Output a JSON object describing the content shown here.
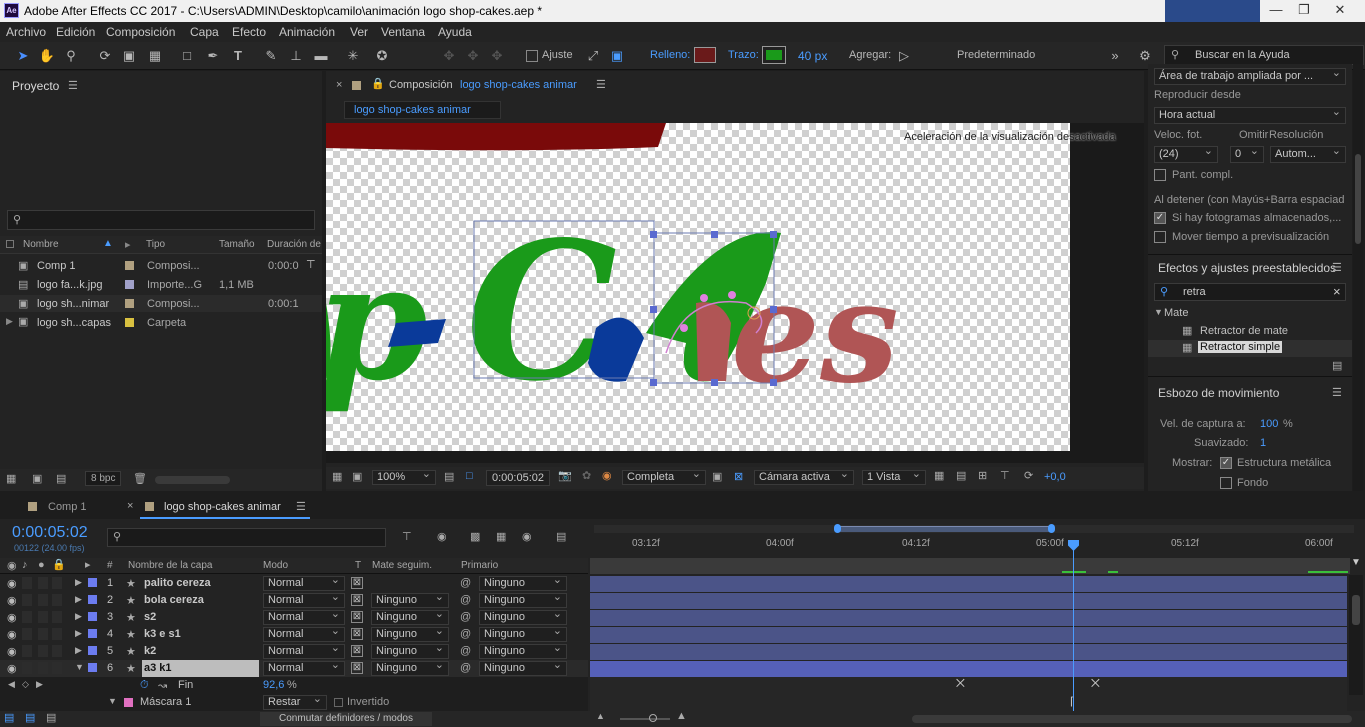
{
  "app": {
    "logo": "Ae",
    "title": "Adobe After Effects CC 2017 - C:\\Users\\ADMIN\\Desktop\\camilo\\animación logo shop-cakes.aep *"
  },
  "menu": [
    "Archivo",
    "Edición",
    "Composición",
    "Capa",
    "Efecto",
    "Animación",
    "Ver",
    "Ventana",
    "Ayuda"
  ],
  "toolbar": {
    "snap_label": "Ajuste",
    "fill_label": "Relleno:",
    "stroke_label": "Trazo:",
    "stroke_width": "40 px",
    "add_label": "Agregar:",
    "workspace": "Predeterminado",
    "help_placeholder": "Buscar en la Ayuda",
    "stroke_color": "#1a9a1a",
    "fill_color": "#8a2020"
  },
  "project": {
    "title": "Proyecto",
    "columns": [
      "Nombre",
      "Tipo",
      "Tamaño",
      "Duración de"
    ],
    "items": [
      {
        "name": "Comp 1",
        "type": "Composi...",
        "size": "",
        "duration": "0:00:0",
        "icon": "comp-icon",
        "label_color": "#b0a080"
      },
      {
        "name": "logo fa...k.jpg",
        "type": "Importe...G",
        "size": "1,1 MB",
        "duration": "",
        "icon": "image-icon",
        "label_color": "#a0a0c8"
      },
      {
        "name": "logo sh...nimar",
        "type": "Composi...",
        "size": "",
        "duration": "0:00:1",
        "icon": "comp-icon",
        "label_color": "#b0a080"
      },
      {
        "name": "logo sh...capas",
        "type": "Carpeta",
        "size": "",
        "duration": "",
        "icon": "folder-icon",
        "label_color": "#d8c040"
      }
    ],
    "bpc": "8 bpc"
  },
  "composition": {
    "panel_label": "Composición",
    "name": "logo shop-cakes animar",
    "tab": "logo shop-cakes animar",
    "accel_note": "Aceleración de la visualización desactivada",
    "zoom": "100%",
    "timecode": "0:00:05:02",
    "quality": "Completa",
    "camera": "Cámara activa",
    "views": "1 Vista",
    "exposure": "+0,0"
  },
  "preview": {
    "workspace_area": "Área de trabajo ampliada por ...",
    "play_from_label": "Reproducir desde",
    "play_from": "Hora actual",
    "fps_label": "Veloc. fot.",
    "skip_label": "Omitir",
    "res_label": "Resolución",
    "fps": "(24)",
    "skip": "0",
    "res": "Autom...",
    "fullscreen": "Pant. compl.",
    "on_stop": "Al detener (con Mayús+Barra espaciad",
    "cached": "Si hay fotogramas almacenados,...",
    "move_time": "Mover tiempo a previsualización"
  },
  "effects": {
    "title": "Efectos y ajustes preestablecidos",
    "search": "retra",
    "group": "Mate",
    "items": [
      "Retractor de mate",
      "Retractor simple"
    ]
  },
  "motion_sketch": {
    "title": "Esbozo de movimiento",
    "capture_label": "Vel. de captura a:",
    "capture_value": "100",
    "capture_unit": "%",
    "smooth_label": "Suavizado:",
    "smooth_value": "1",
    "show_label": "Mostrar:",
    "wireframe": "Estructura metálica",
    "background": "Fondo"
  },
  "timeline": {
    "tabs": [
      "Comp 1",
      "logo shop-cakes animar"
    ],
    "timecode": "0:00:05:02",
    "frames": "00122 (24.00 fps)",
    "ruler": [
      "03:12f",
      "04:00f",
      "04:12f",
      "05:00f",
      "05:12f",
      "06:00f"
    ],
    "columns": {
      "name": "Nombre de la capa",
      "mode": "Modo",
      "t": "T",
      "trkmat": "Mate seguim.",
      "parent": "Primario"
    },
    "layers": [
      {
        "num": "1",
        "name": "palito cereza",
        "mode": "Normal",
        "trkmat": "",
        "parent": "Ninguno"
      },
      {
        "num": "2",
        "name": "bola cereza",
        "mode": "Normal",
        "trkmat": "Ninguno",
        "parent": "Ninguno"
      },
      {
        "num": "3",
        "name": "s2",
        "mode": "Normal",
        "trkmat": "Ninguno",
        "parent": "Ninguno"
      },
      {
        "num": "4",
        "name": "k3 e s1",
        "mode": "Normal",
        "trkmat": "Ninguno",
        "parent": "Ninguno"
      },
      {
        "num": "5",
        "name": "k2",
        "mode": "Normal",
        "trkmat": "Ninguno",
        "parent": "Ninguno"
      },
      {
        "num": "6",
        "name": "a3 k1",
        "mode": "Normal",
        "trkmat": "Ninguno",
        "parent": "Ninguno"
      }
    ],
    "prop_name": "Fin",
    "prop_value": "92,6",
    "prop_unit": "%",
    "mask_name": "Máscara 1",
    "mask_mode": "Restar",
    "mask_inverted": "Invertido",
    "toggle_label": "Conmutar definidores / modos"
  }
}
